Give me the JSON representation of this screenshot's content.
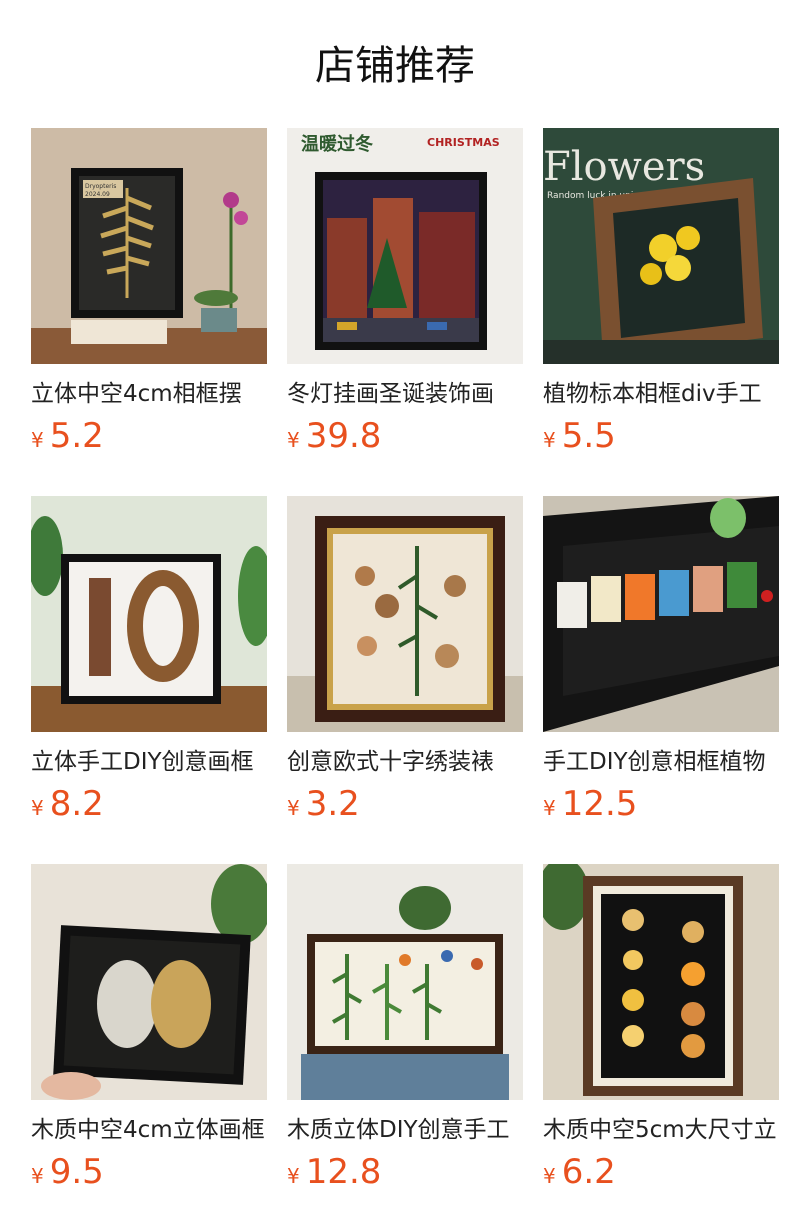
{
  "section_title": "店铺推荐",
  "currency": "¥",
  "products": [
    {
      "name": "立体中空4cm相框摆",
      "price": "5.2",
      "image": "fern-specimen-frame"
    },
    {
      "name": "冬灯挂画圣诞装饰画",
      "price": "39.8",
      "image": "christmas-painting"
    },
    {
      "name": "植物标本相框div手工",
      "price": "5.5",
      "image": "flower-shadow-box"
    },
    {
      "name": "立体手工DIY创意画框",
      "price": "8.2",
      "image": "number-ten-flower-frame"
    },
    {
      "name": "创意欧式十字绣装裱",
      "price": "3.2",
      "image": "mushroom-print-frame"
    },
    {
      "name": "手工DIY创意相框植物",
      "price": "12.5",
      "image": "specimen-strip-frame"
    },
    {
      "name": "木质中空4cm立体画框",
      "price": "9.5",
      "image": "butterfly-flower-frame"
    },
    {
      "name": "木质立体DIY创意手工",
      "price": "12.8",
      "image": "fern-butterfly-frame"
    },
    {
      "name": "木质中空5cm大尺寸立",
      "price": "6.2",
      "image": "lit-shell-frame"
    }
  ],
  "thumb_texts": {
    "fern_label_1": "Dryopteris",
    "fern_label_2": "2024.09",
    "xmas_1": "温暖过冬",
    "xmas_2": "CHRISTMAS",
    "flowers_1": "Flowers",
    "flowers_2": "Random luck in universe"
  },
  "colors": {
    "price": "#e8501e",
    "text": "#222222"
  }
}
